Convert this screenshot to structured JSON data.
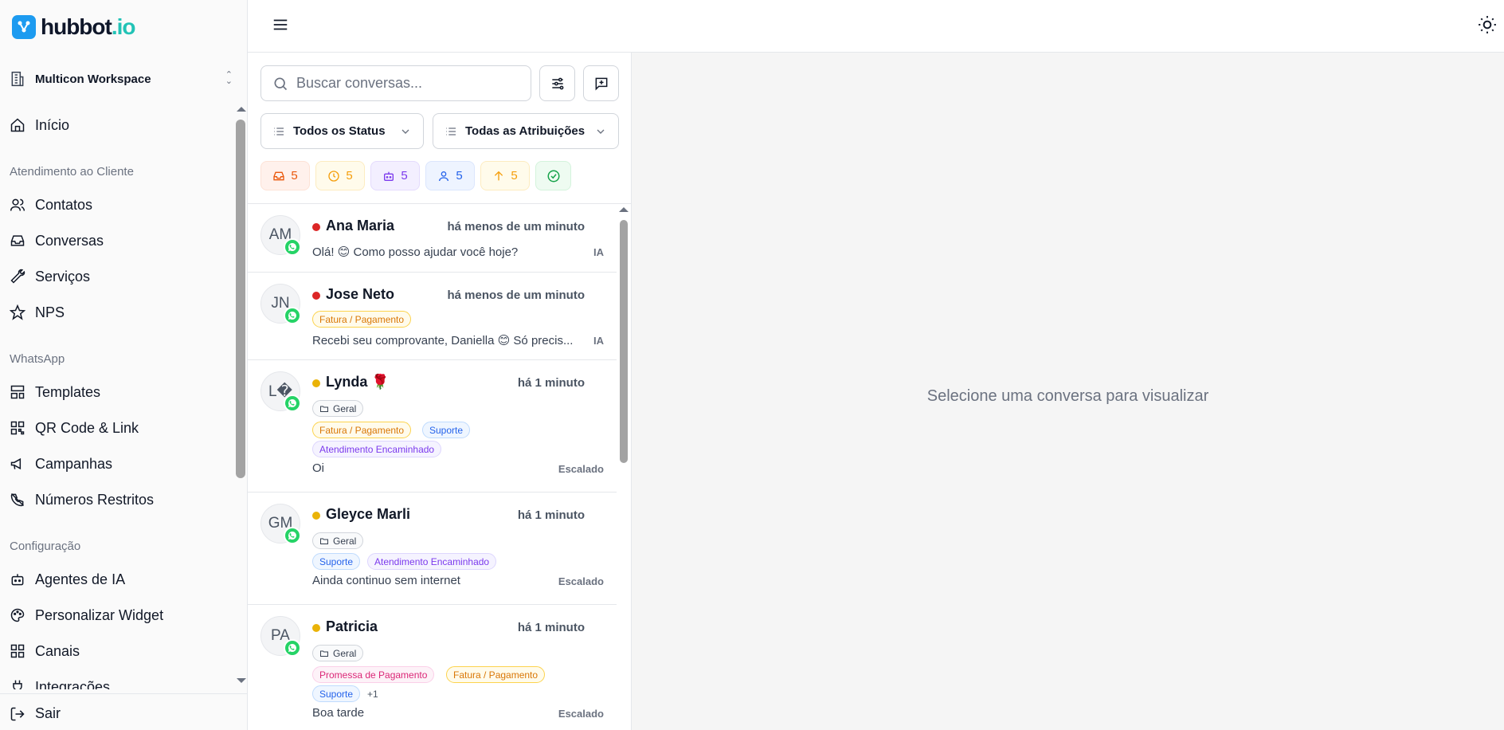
{
  "brand": {
    "name": "hubbot",
    "suffix": ".io"
  },
  "workspace": {
    "name": "Multicon Workspace"
  },
  "sidebar": {
    "home": "Início",
    "sections": [
      {
        "label": "Atendimento ao Cliente",
        "items": [
          "Contatos",
          "Conversas",
          "Serviços",
          "NPS"
        ]
      },
      {
        "label": "WhatsApp",
        "items": [
          "Templates",
          "QR Code & Link",
          "Campanhas",
          "Números Restritos"
        ]
      },
      {
        "label": "Configuração",
        "items": [
          "Agentes de IA",
          "Personalizar Widget",
          "Canais",
          "Integrações"
        ]
      }
    ],
    "logout": "Sair"
  },
  "search": {
    "placeholder": "Buscar conversas..."
  },
  "filters": {
    "status": "Todos os Status",
    "assignment": "Todas as Atribuições"
  },
  "chips": [
    {
      "icon": "inbox-icon",
      "count": "5",
      "color": "#ea580c",
      "bg": "#fff1ec"
    },
    {
      "icon": "clock-icon",
      "count": "5",
      "color": "#f59e0b",
      "bg": "#fffbeb"
    },
    {
      "icon": "bot-icon",
      "count": "5",
      "color": "#7c3aed",
      "bg": "#f3efff"
    },
    {
      "icon": "user-icon",
      "count": "5",
      "color": "#2563eb",
      "bg": "#eef4ff"
    },
    {
      "icon": "arrow-up-icon",
      "count": "5",
      "color": "#f59e0b",
      "bg": "#fffbeb"
    },
    {
      "icon": "check-circle-icon",
      "count": "",
      "color": "#16a34a",
      "bg": "#eefbf1"
    }
  ],
  "conversations": [
    {
      "initials": "AM",
      "name": "Ana Maria",
      "time": "há menos de um minuto",
      "status_color": "#dc2626",
      "folder": "",
      "tags": [],
      "preview": "Olá! 😊 Como posso ajudar você hoje?",
      "meta": "IA"
    },
    {
      "initials": "JN",
      "name": "Jose Neto",
      "time": "há menos de um minuto",
      "status_color": "#dc2626",
      "folder": "",
      "tags": [
        "Fatura / Pagamento"
      ],
      "preview": "Recebi seu comprovante, Daniella 😊 Só precis...",
      "meta": "IA"
    },
    {
      "initials": "L�",
      "name": "Lynda 🌹",
      "time": "há 1 minuto",
      "status_color": "#eab308",
      "folder": "Geral",
      "tags": [
        "Fatura / Pagamento",
        "Suporte",
        "Atendimento Encaminhado"
      ],
      "preview": "Oi",
      "meta": "Escalado"
    },
    {
      "initials": "GM",
      "name": "Gleyce Marli",
      "time": "há 1 minuto",
      "status_color": "#eab308",
      "folder": "Geral",
      "tags": [
        "Suporte",
        "Atendimento Encaminhado"
      ],
      "preview": "Ainda continuo sem internet",
      "meta": "Escalado"
    },
    {
      "initials": "PA",
      "name": "Patricia",
      "time": "há 1 minuto",
      "status_color": "#eab308",
      "folder": "Geral",
      "tags": [
        "Promessa de Pagamento",
        "Fatura / Pagamento",
        "Suporte"
      ],
      "more": "+1",
      "preview": "Boa tarde",
      "meta": "Escalado"
    }
  ],
  "main": {
    "empty_message": "Selecione uma conversa para visualizar"
  }
}
